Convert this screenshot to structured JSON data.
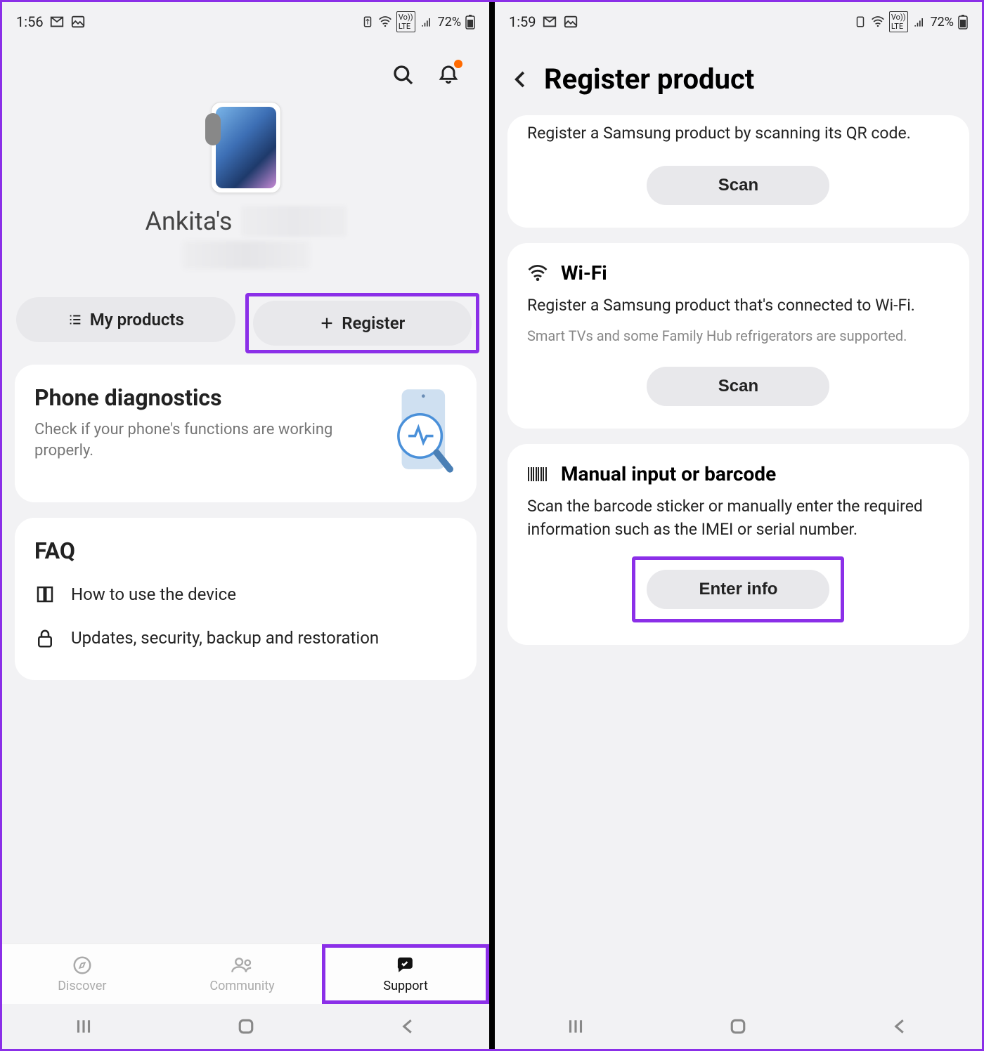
{
  "left": {
    "status": {
      "time": "1:56",
      "battery": "72%"
    },
    "device_name": "Ankita's",
    "pills": {
      "my_products": "My products",
      "register": "Register"
    },
    "diagnostics": {
      "title": "Phone diagnostics",
      "sub": "Check if your phone's functions are working properly."
    },
    "faq": {
      "title": "FAQ",
      "item1": "How to use the device",
      "item2": "Updates, security, backup and restoration"
    },
    "nav": {
      "discover": "Discover",
      "community": "Community",
      "support": "Support"
    }
  },
  "right": {
    "status": {
      "time": "1:59",
      "battery": "72%"
    },
    "page_title": "Register product",
    "qr": {
      "desc": "Register a Samsung product by scanning its QR code.",
      "btn": "Scan"
    },
    "wifi": {
      "title": "Wi-Fi",
      "desc": "Register a Samsung product that's connected to Wi-Fi.",
      "note": "Smart TVs and some Family Hub refrigerators are supported.",
      "btn": "Scan"
    },
    "manual": {
      "title": "Manual input or barcode",
      "desc": "Scan the barcode sticker or manually enter the required information such as the IMEI or serial number.",
      "btn": "Enter info"
    }
  }
}
